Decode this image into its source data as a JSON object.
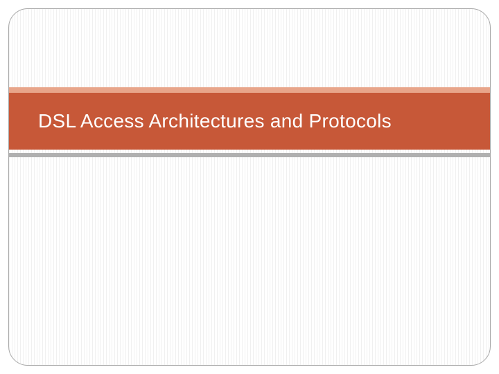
{
  "slide": {
    "title": "DSL Access Architectures and Protocols"
  },
  "colors": {
    "title_band": "#c75838",
    "top_stripe": "#e8a58a",
    "bottom_stripe": "#b0b0b0",
    "frame_border": "#a9a9a9"
  }
}
